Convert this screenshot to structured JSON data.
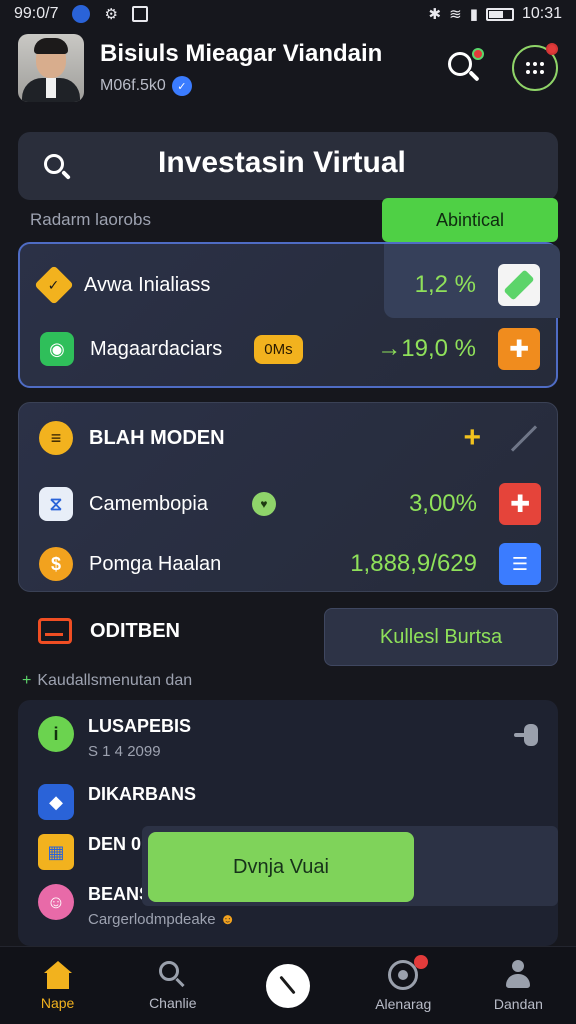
{
  "status_bar": {
    "time_left": "99:0/7",
    "time_right": "10:31"
  },
  "header": {
    "user_name": "Bisiuls Mieagar Viandain",
    "user_subtitle": "M06f.5k0",
    "avatar_icon": "profile-photo",
    "search_icon": "search-icon",
    "menu_icon": "dots-grid-icon"
  },
  "search_card": {
    "title": "Investasin Virtual"
  },
  "filter": {
    "label": "Radarm laorobs",
    "action_label": "Abintical"
  },
  "card_a": {
    "rows": [
      {
        "label": "Avwa Inialiass",
        "value": "1,2 %",
        "icon": "diamond-icon",
        "action_icon": "check-tile-icon"
      },
      {
        "label": "Magaardaciars",
        "tag": "0Ms",
        "value": "→19,0 %",
        "icon": "camera-icon",
        "action_icon": "plus-icon"
      }
    ]
  },
  "card_b": {
    "rows": [
      {
        "label": "BLAH MODEN",
        "icon": "wallet-icon",
        "action_icon": "plus-icon"
      },
      {
        "label": "Camembopia",
        "value": "3,00%",
        "icon": "bank-icon",
        "action_icon": "plus-icon"
      },
      {
        "label": "Pomga Haalan",
        "value": "1,888,9/629",
        "icon": "coin-icon",
        "action_icon": "list-icon"
      }
    ]
  },
  "section": {
    "title": "ODITBEN",
    "button_label": "Kullesl Burtsa",
    "hint": "Kaudallsmenutan dan"
  },
  "list": {
    "items": [
      {
        "title": "LUSAPEBIS",
        "subtitle": "S 1 4 2099",
        "icon": "leaf-icon"
      },
      {
        "title": "DIKARBANS",
        "subtitle": "",
        "icon": "chart-icon"
      },
      {
        "title": "DEN 0",
        "subtitle": "",
        "icon": "grid-icon"
      },
      {
        "title": "BEANS",
        "subtitle": "Cargerlodmpdeake",
        "icon": "face-icon"
      }
    ],
    "toast_label": "Dvnja Vuai"
  },
  "bottom_nav": {
    "items": [
      {
        "label": "Nape",
        "icon": "home-icon",
        "active": true
      },
      {
        "label": "Chanlie",
        "icon": "search-icon"
      },
      {
        "label": "",
        "icon": "clock-icon"
      },
      {
        "label": "Alenarag",
        "icon": "chat-icon"
      },
      {
        "label": "Dandan",
        "icon": "user-icon"
      }
    ]
  },
  "colors": {
    "accent_green": "#8fe15a",
    "accent_orange": "#f2b21e",
    "background": "#16171d"
  }
}
